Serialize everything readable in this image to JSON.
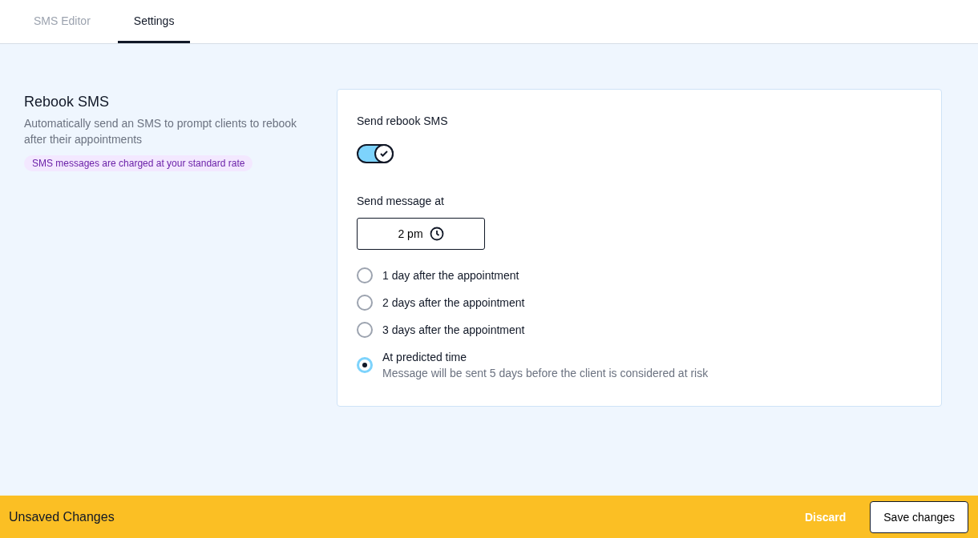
{
  "tabs": [
    {
      "label": "SMS Editor",
      "selected": false
    },
    {
      "label": "Settings",
      "selected": true
    }
  ],
  "section": {
    "title": "Rebook SMS",
    "description": "Automatically send an SMS to prompt clients to rebook after their appointments",
    "badge": "SMS messages are charged at your standard rate"
  },
  "settings": {
    "toggle_label": "Send rebook SMS",
    "toggle_on": true,
    "time_label": "Send message at",
    "time_value": "2 pm",
    "options": [
      {
        "label": "1 day after the appointment",
        "selected": false
      },
      {
        "label": "2 days after the appointment",
        "selected": false
      },
      {
        "label": "3 days after the appointment",
        "selected": false
      },
      {
        "label": "At predicted time",
        "hint": "Message will be sent 5 days before the client is considered at risk",
        "selected": true
      }
    ]
  },
  "footer": {
    "status": "Unsaved Changes",
    "discard": "Discard",
    "save": "Save changes"
  }
}
